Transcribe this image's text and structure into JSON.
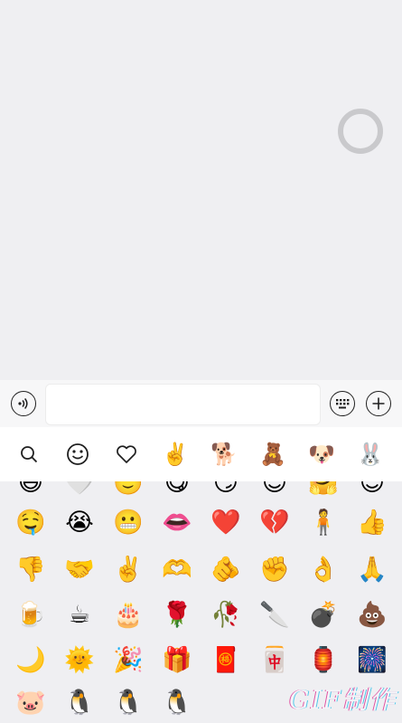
{
  "colors": {
    "background": "#efeff2",
    "toolbar": "#ffffff",
    "icon": "#1f1f1f"
  },
  "input_bar": {
    "voice_icon": "voice-icon",
    "input_value": "",
    "keyboard_icon": "keyboard-icon",
    "add_icon": "plus-icon"
  },
  "toolbar": {
    "tabs": [
      {
        "name": "search",
        "glyph": ""
      },
      {
        "name": "emoji",
        "glyph": ""
      },
      {
        "name": "favorites",
        "glyph": ""
      },
      {
        "name": "gestures",
        "glyph": "✌️"
      },
      {
        "name": "shiba-stickers",
        "glyph": "🐕"
      },
      {
        "name": "bear-stickers",
        "glyph": "🧸"
      },
      {
        "name": "dog-stickers",
        "glyph": "🐶"
      },
      {
        "name": "rabbit-stickers",
        "glyph": "🐰"
      }
    ]
  },
  "emoji_grid": {
    "partial_row": [
      "😄",
      "🤍",
      "🙂",
      "😋",
      "😏",
      "😊",
      "🤗",
      "😉"
    ],
    "rows": [
      [
        "🤤",
        "😭",
        "😬",
        "👄",
        "❤️",
        "💔",
        "🧍",
        "👍"
      ],
      [
        "👎",
        "🤝",
        "✌️",
        "🫶",
        "🫵",
        "✊",
        "👌",
        "🙏"
      ],
      [
        "🍺",
        "☕",
        "🎂",
        "🌹",
        "🥀",
        "🔪",
        "💣",
        "💩"
      ],
      [
        "🌙",
        "🌞",
        "🎉",
        "🎁",
        "🧧",
        "🀄",
        "🏮",
        "🎆"
      ],
      [
        "🐷",
        "🐧",
        "🐧",
        "🐧"
      ]
    ]
  },
  "watermark": "GIF制作"
}
